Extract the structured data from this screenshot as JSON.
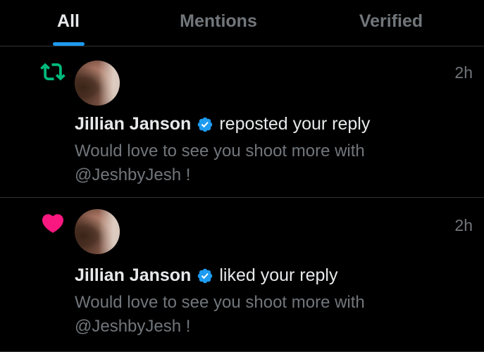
{
  "tabs": [
    {
      "label": "All",
      "active": true
    },
    {
      "label": "Mentions",
      "active": false
    },
    {
      "label": "Verified",
      "active": false
    }
  ],
  "colors": {
    "accent": "#1d9bf0",
    "repost": "#00ba7c",
    "like": "#f91880",
    "muted": "#71767b",
    "text": "#e7e9ea",
    "background": "#000000"
  },
  "notifications": [
    {
      "type_icon": "repost-icon",
      "user_name": "Jillian Janson",
      "verified": true,
      "action": "reposted your reply",
      "time": "2h",
      "reply_text": "Would love to see you shoot more with @JeshbyJesh !"
    },
    {
      "type_icon": "heart-icon",
      "user_name": "Jillian Janson",
      "verified": true,
      "action": "liked your reply",
      "time": "2h",
      "reply_text": "Would love to see you shoot more with @JeshbyJesh !"
    }
  ]
}
